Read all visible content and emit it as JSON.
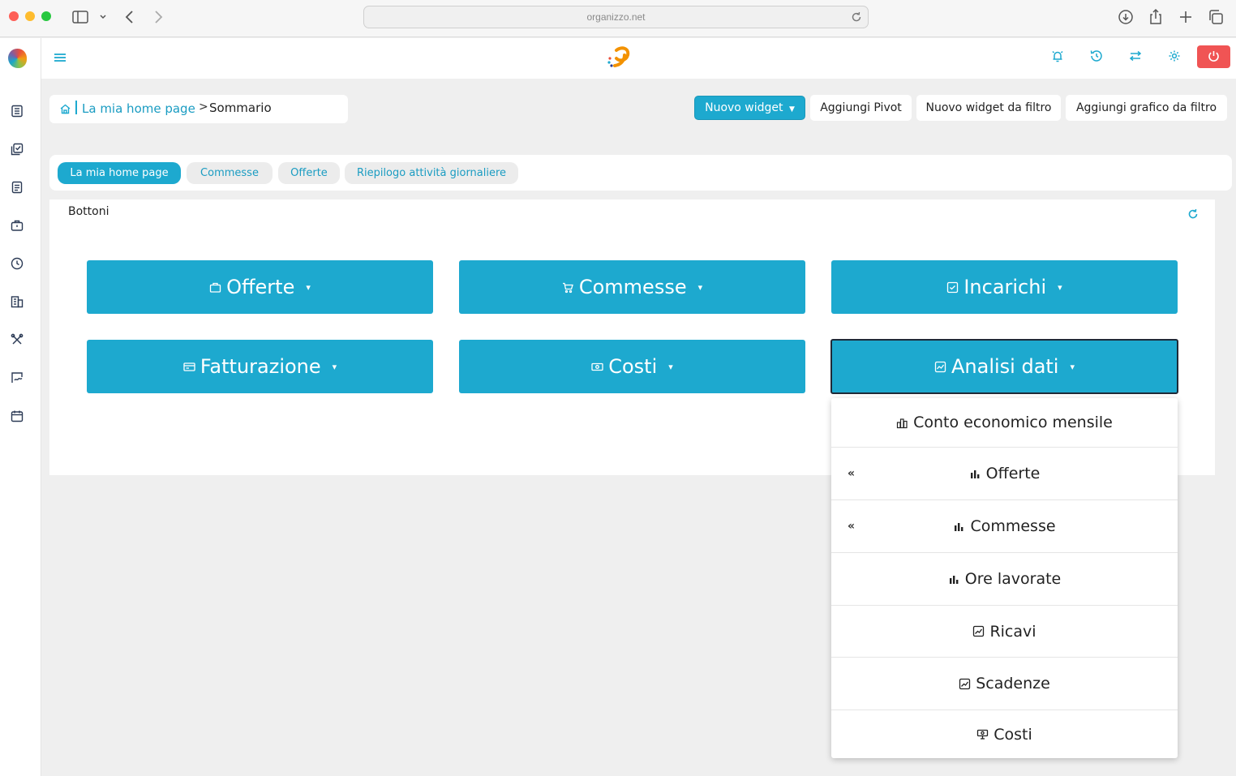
{
  "browser": {
    "url": "organizzo.net"
  },
  "breadcrumb": {
    "home_link": "La mia home page",
    "separator": ">",
    "current": "Sommario"
  },
  "toolbar": {
    "new_widget": "Nuovo widget",
    "add_pivot": "Aggiungi Pivot",
    "new_widget_from_filter": "Nuovo widget da filtro",
    "add_chart_from_filter": "Aggiungi grafico da filtro"
  },
  "tabs": [
    {
      "label": "La mia home page",
      "active": true
    },
    {
      "label": "Commesse",
      "active": false
    },
    {
      "label": "Offerte",
      "active": false
    },
    {
      "label": "Riepilogo attività giornaliere",
      "active": false
    }
  ],
  "panel": {
    "title": "Bottoni",
    "buttons": [
      {
        "label": "Offerte",
        "icon": "briefcase-icon"
      },
      {
        "label": "Commesse",
        "icon": "cart-icon"
      },
      {
        "label": "Incarichi",
        "icon": "checkbox-icon"
      },
      {
        "label": "Fatturazione",
        "icon": "invoice-icon"
      },
      {
        "label": "Costi",
        "icon": "money-icon"
      },
      {
        "label": "Analisi dati",
        "icon": "chart-box-icon"
      }
    ]
  },
  "dropdown": {
    "items": [
      {
        "label": "Conto economico mensile",
        "icon": "bar-chart-outline-icon",
        "prefix": ""
      },
      {
        "label": "Offerte",
        "icon": "bar-chart-icon",
        "prefix": "«"
      },
      {
        "label": "Commesse",
        "icon": "bar-chart-icon",
        "prefix": "«"
      },
      {
        "label": "Ore lavorate",
        "icon": "bar-chart-icon",
        "prefix": ""
      },
      {
        "label": "Ricavi",
        "icon": "trend-chart-icon",
        "prefix": ""
      },
      {
        "label": "Scadenze",
        "icon": "trend-chart-icon",
        "prefix": ""
      },
      {
        "label": "Costi",
        "icon": "coins-icon",
        "prefix": ""
      }
    ]
  },
  "colors": {
    "accent": "#1da9cf",
    "danger": "#f05454",
    "background": "#efefef"
  }
}
